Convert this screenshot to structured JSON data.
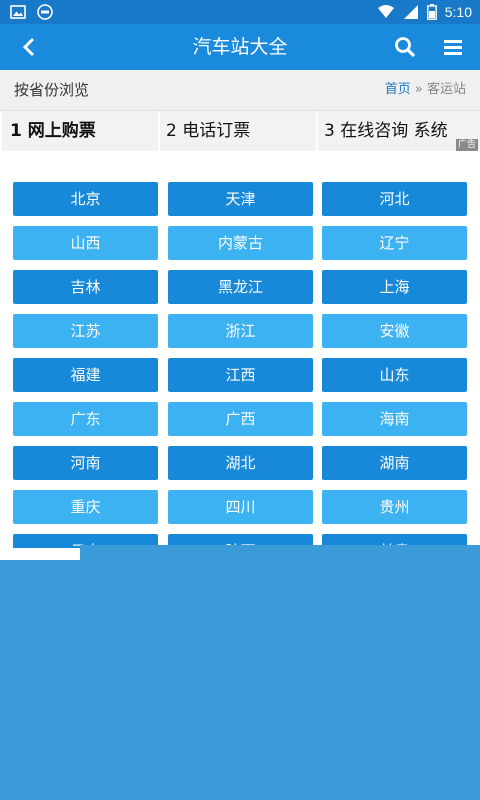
{
  "status_bar": {
    "time": "5:10",
    "icons": [
      "image-icon",
      "vpn-icon",
      "wifi-icon",
      "signal-icon",
      "battery-icon"
    ]
  },
  "app_bar": {
    "title": "汽车站大全",
    "icons": [
      "back-icon",
      "search-icon",
      "menu-icon"
    ]
  },
  "breadcrumb": {
    "section_title": "按省份浏览",
    "home": "首页",
    "separator": "»",
    "current": "客运站"
  },
  "ad_bar": {
    "items": [
      "1 网上购票",
      "2 电话订票",
      "3 在线咨询 系统"
    ],
    "tag": "广告"
  },
  "provinces": [
    "北京",
    "天津",
    "河北",
    "山西",
    "内蒙古",
    "辽宁",
    "吉林",
    "黑龙江",
    "上海",
    "江苏",
    "浙江",
    "安徽",
    "福建",
    "江西",
    "山东",
    "广东",
    "广西",
    "海南",
    "河南",
    "湖北",
    "湖南",
    "重庆",
    "四川",
    "贵州",
    "云南",
    "陕西",
    "甘肃"
  ],
  "colors": {
    "status_bar": "#1779c8",
    "app_bar": "#1a8bdc",
    "button_dark": "#1889d8",
    "button_light": "#3db2f2",
    "overlay": "#3b9bd9"
  }
}
